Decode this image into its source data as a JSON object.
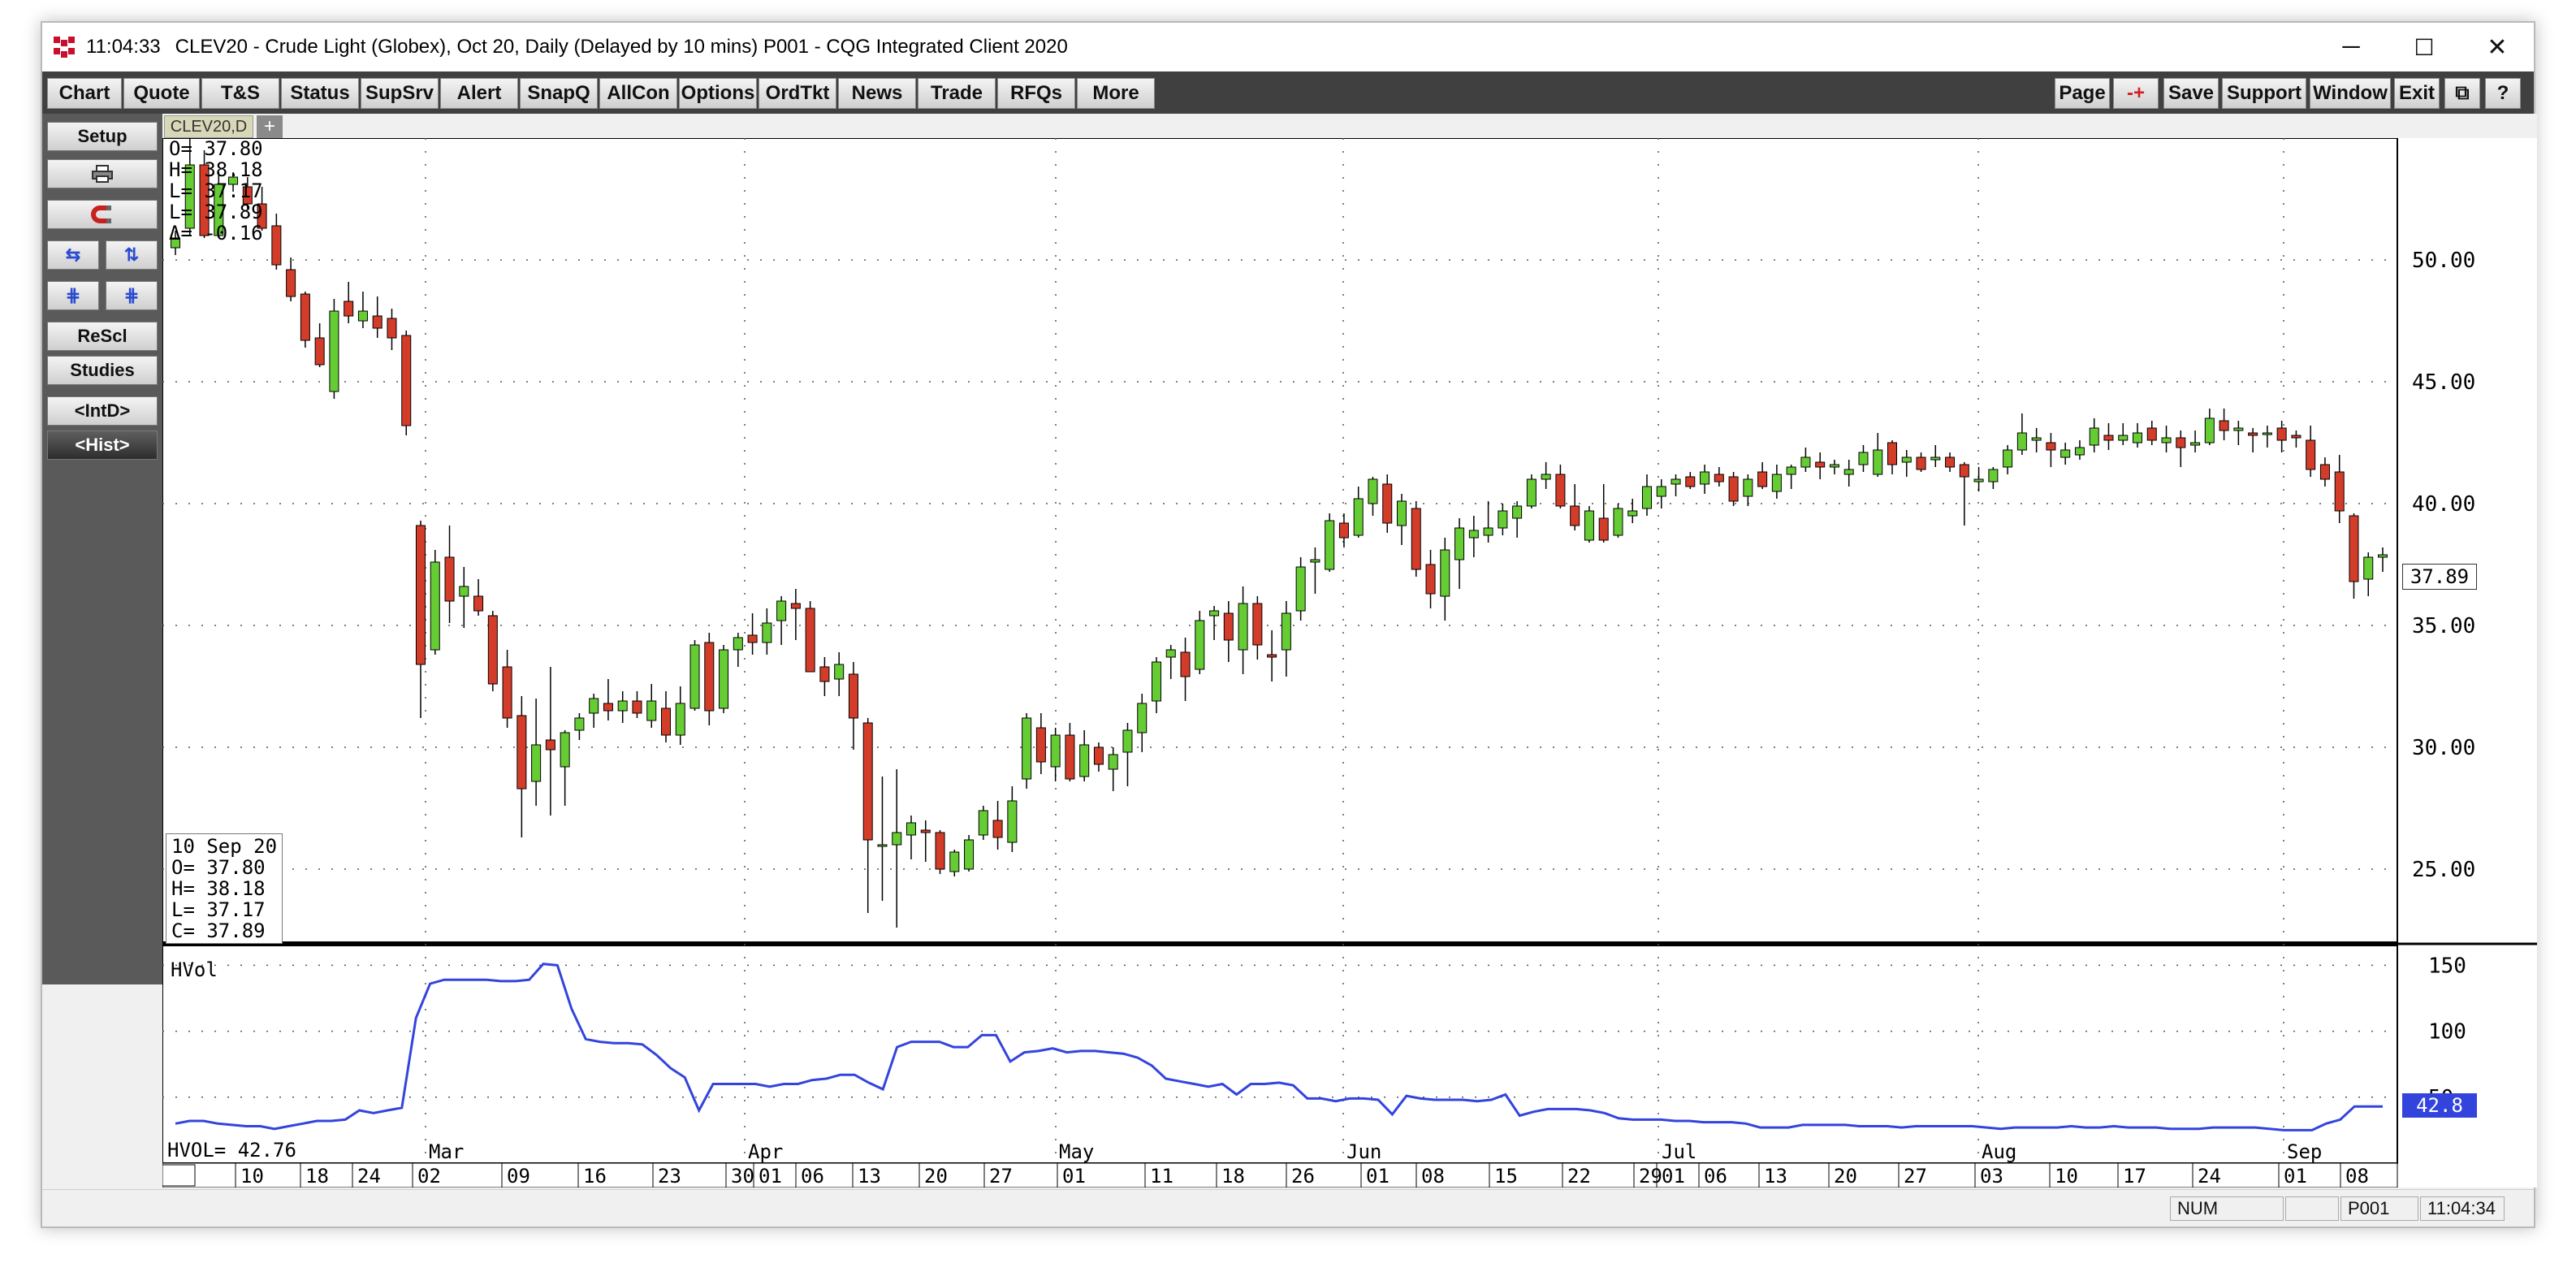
{
  "titlebar": {
    "time": "11:04:33",
    "title": "CLEV20 - Crude Light (Globex), Oct 20, Daily (Delayed by 10 mins)   P001 - CQG Integrated Client 2020",
    "minimize": "─",
    "maximize": "☐",
    "close": "✕"
  },
  "toolbar": {
    "left_buttons": [
      "Chart",
      "Quote",
      "T&S",
      "Status",
      "SupSrv",
      "Alert",
      "SnapQ",
      "AllCon",
      "Options",
      "OrdTkt",
      "News",
      "Trade",
      "RFQs",
      "More"
    ],
    "right_buttons": [
      "Page",
      "-+",
      "Save",
      "Support",
      "Window",
      "Exit",
      "⧉",
      "?"
    ]
  },
  "leftpanel": {
    "setup": "Setup",
    "print_icon": "print-icon",
    "magnet_icon": "magnet-icon",
    "arrows_lr": "⇆",
    "arrows_ud": "⇅",
    "grid_a": "⋕",
    "grid_b": "⋕",
    "rescl": "ReScl",
    "studies": "Studies",
    "intd": "<IntD>",
    "hist": "<Hist>"
  },
  "tabs": {
    "active": "CLEV20,D",
    "add": "+"
  },
  "ohlc_box": {
    "o": "O=  37.80",
    "h": "H=  38.18",
    "l": "L=  37.17",
    "l2": "L=  37.89",
    "d": "Δ=  -0.16"
  },
  "cursor_box": {
    "date": "10 Sep 20",
    "o": "O=   37.80",
    "h": "H=   38.18",
    "l": "L=   37.17",
    "c": "C=   37.89"
  },
  "last_price": "37.89",
  "hvol": {
    "label": "HVol",
    "readout": "HVOL=  42.76",
    "last": "42.8"
  },
  "status": {
    "num": "NUM",
    "page": "P001",
    "time": "11:04:34"
  },
  "chart_data": [
    {
      "type": "candlestick",
      "title": "",
      "ylim": [
        22,
        55
      ],
      "y_ticks": [
        "50.00",
        "45.00",
        "40.00",
        "35.00",
        "30.00",
        "25.00"
      ],
      "y_tick_values": [
        50,
        45,
        40,
        35,
        30,
        25
      ],
      "month_labels": [
        "Mar",
        "Apr",
        "May",
        "Jun",
        "Jul",
        "Aug",
        "Sep"
      ],
      "day_labels": [
        "10",
        "18",
        "24",
        "02",
        "09",
        "16",
        "23",
        "30",
        "01",
        "06",
        "13",
        "20",
        "27",
        "01",
        "11",
        "18",
        "26",
        "01",
        "08",
        "15",
        "22",
        "29",
        "01",
        "06",
        "13",
        "20",
        "27",
        "03",
        "10",
        "17",
        "24",
        "01",
        "08"
      ],
      "colors": {
        "up": "#66cc33",
        "down": "#d43c2a",
        "grid": "#555555"
      },
      "candles": [
        [
          50.5,
          51.2,
          50.2,
          50.9
        ],
        [
          51.3,
          56.0,
          51.0,
          53.9
        ],
        [
          53.9,
          54.5,
          50.9,
          51.0
        ],
        [
          51.0,
          53.6,
          50.9,
          53.1
        ],
        [
          53.1,
          53.6,
          52.8,
          53.4
        ],
        [
          53.0,
          53.4,
          52.1,
          52.3
        ],
        [
          52.3,
          53.0,
          51.2,
          51.3
        ],
        [
          51.4,
          51.9,
          49.6,
          49.8
        ],
        [
          49.6,
          50.1,
          48.3,
          48.5
        ],
        [
          48.6,
          48.7,
          46.4,
          46.7
        ],
        [
          46.8,
          47.4,
          45.6,
          45.7
        ],
        [
          44.6,
          48.4,
          44.3,
          47.9
        ],
        [
          48.3,
          49.1,
          47.4,
          47.7
        ],
        [
          47.5,
          48.7,
          47.2,
          47.9
        ],
        [
          47.7,
          48.5,
          46.8,
          47.2
        ],
        [
          47.6,
          48.0,
          46.3,
          46.8
        ],
        [
          46.9,
          47.1,
          42.8,
          43.2
        ],
        [
          39.1,
          39.3,
          31.2,
          33.4
        ],
        [
          34.0,
          38.1,
          33.8,
          37.6
        ],
        [
          37.8,
          39.1,
          35.1,
          36.0
        ],
        [
          36.2,
          37.4,
          34.9,
          36.6
        ],
        [
          36.2,
          36.9,
          35.4,
          35.6
        ],
        [
          35.4,
          35.6,
          32.3,
          32.6
        ],
        [
          33.3,
          34.0,
          30.8,
          31.2
        ],
        [
          31.3,
          32.1,
          26.3,
          28.3
        ],
        [
          28.6,
          32.0,
          27.6,
          30.1
        ],
        [
          30.3,
          33.3,
          27.2,
          29.9
        ],
        [
          29.2,
          30.7,
          27.6,
          30.6
        ],
        [
          30.7,
          31.4,
          30.3,
          31.2
        ],
        [
          31.4,
          32.2,
          30.8,
          32.0
        ],
        [
          31.8,
          32.8,
          31.1,
          31.5
        ],
        [
          31.5,
          32.3,
          31.0,
          31.9
        ],
        [
          31.9,
          32.3,
          31.2,
          31.4
        ],
        [
          31.1,
          32.6,
          30.8,
          31.9
        ],
        [
          31.6,
          32.3,
          30.2,
          30.5
        ],
        [
          30.5,
          32.5,
          30.1,
          31.8
        ],
        [
          31.6,
          34.4,
          31.5,
          34.2
        ],
        [
          34.3,
          34.7,
          30.9,
          31.5
        ],
        [
          31.6,
          34.2,
          31.4,
          34.0
        ],
        [
          34.0,
          34.7,
          33.3,
          34.5
        ],
        [
          34.6,
          35.5,
          33.8,
          34.3
        ],
        [
          34.3,
          35.7,
          33.8,
          35.1
        ],
        [
          35.2,
          36.2,
          34.2,
          36.0
        ],
        [
          35.9,
          36.5,
          34.4,
          35.7
        ],
        [
          35.7,
          36.0,
          33.1,
          33.1
        ],
        [
          33.3,
          33.7,
          32.1,
          32.7
        ],
        [
          32.8,
          33.9,
          32.1,
          33.4
        ],
        [
          33.0,
          33.5,
          29.9,
          31.2
        ],
        [
          31.0,
          31.2,
          23.2,
          26.2
        ],
        [
          26.0,
          28.8,
          23.7,
          26.0
        ],
        [
          26.0,
          29.1,
          22.6,
          26.5
        ],
        [
          26.4,
          27.2,
          25.4,
          26.9
        ],
        [
          26.6,
          27.0,
          25.3,
          26.5
        ],
        [
          26.5,
          26.6,
          24.8,
          25.0
        ],
        [
          24.9,
          25.8,
          24.7,
          25.7
        ],
        [
          25.0,
          26.4,
          24.9,
          26.2
        ],
        [
          26.4,
          27.6,
          26.2,
          27.4
        ],
        [
          27.0,
          27.8,
          25.8,
          26.3
        ],
        [
          26.1,
          28.4,
          25.7,
          27.8
        ],
        [
          28.7,
          31.4,
          28.3,
          31.2
        ],
        [
          30.8,
          31.4,
          28.9,
          29.4
        ],
        [
          29.2,
          30.8,
          28.6,
          30.5
        ],
        [
          30.5,
          31.0,
          28.6,
          28.7
        ],
        [
          28.8,
          30.7,
          28.6,
          30.1
        ],
        [
          30.0,
          30.2,
          29.0,
          29.3
        ],
        [
          29.1,
          30.0,
          28.2,
          29.7
        ],
        [
          29.8,
          31.0,
          28.4,
          30.7
        ],
        [
          30.6,
          32.2,
          29.8,
          31.8
        ],
        [
          31.9,
          33.7,
          31.4,
          33.5
        ],
        [
          33.7,
          34.2,
          32.8,
          34.0
        ],
        [
          33.9,
          34.5,
          31.9,
          32.9
        ],
        [
          33.2,
          35.6,
          33.0,
          35.2
        ],
        [
          35.4,
          35.8,
          34.4,
          35.6
        ],
        [
          35.5,
          36.0,
          33.5,
          34.4
        ],
        [
          34.0,
          36.6,
          33.0,
          35.9
        ],
        [
          35.9,
          36.2,
          33.6,
          34.2
        ],
        [
          33.8,
          34.8,
          32.7,
          33.7
        ],
        [
          34.0,
          36.0,
          32.9,
          35.5
        ],
        [
          35.6,
          37.8,
          35.2,
          37.4
        ],
        [
          37.6,
          38.2,
          36.3,
          37.7
        ],
        [
          37.3,
          39.6,
          37.2,
          39.3
        ],
        [
          39.2,
          39.6,
          38.2,
          38.6
        ],
        [
          38.7,
          40.7,
          38.6,
          40.2
        ],
        [
          40.0,
          41.1,
          39.5,
          41.0
        ],
        [
          40.8,
          41.2,
          38.8,
          39.2
        ],
        [
          39.1,
          40.4,
          38.3,
          40.1
        ],
        [
          39.8,
          40.1,
          37.0,
          37.3
        ],
        [
          37.5,
          38.1,
          35.7,
          36.3
        ],
        [
          36.2,
          38.6,
          35.2,
          38.1
        ],
        [
          37.7,
          39.4,
          36.5,
          39.0
        ],
        [
          38.6,
          39.5,
          37.8,
          38.9
        ],
        [
          38.7,
          40.1,
          38.4,
          39.0
        ],
        [
          39.0,
          40.0,
          38.7,
          39.7
        ],
        [
          39.4,
          40.1,
          38.6,
          39.9
        ],
        [
          39.9,
          41.2,
          39.8,
          41.0
        ],
        [
          41.0,
          41.7,
          40.6,
          41.2
        ],
        [
          41.2,
          41.6,
          39.8,
          39.9
        ],
        [
          39.9,
          40.8,
          38.9,
          39.1
        ],
        [
          38.5,
          39.9,
          38.4,
          39.7
        ],
        [
          39.4,
          40.8,
          38.4,
          38.5
        ],
        [
          38.7,
          40.0,
          38.6,
          39.8
        ],
        [
          39.5,
          40.2,
          39.2,
          39.7
        ],
        [
          39.8,
          41.2,
          39.5,
          40.7
        ],
        [
          40.3,
          41.0,
          39.8,
          40.7
        ],
        [
          40.8,
          41.2,
          40.3,
          41.0
        ],
        [
          41.1,
          41.3,
          40.6,
          40.7
        ],
        [
          40.8,
          41.6,
          40.4,
          41.3
        ],
        [
          41.2,
          41.5,
          40.7,
          40.9
        ],
        [
          41.1,
          41.3,
          39.9,
          40.1
        ],
        [
          40.3,
          41.2,
          39.9,
          41.0
        ],
        [
          41.3,
          41.7,
          40.6,
          40.7
        ],
        [
          40.5,
          41.6,
          40.2,
          41.2
        ],
        [
          41.2,
          41.6,
          40.6,
          41.5
        ],
        [
          41.5,
          42.3,
          41.3,
          41.9
        ],
        [
          41.7,
          42.1,
          41.0,
          41.5
        ],
        [
          41.5,
          41.8,
          41.2,
          41.6
        ],
        [
          41.2,
          41.8,
          40.7,
          41.4
        ],
        [
          41.6,
          42.4,
          41.3,
          42.1
        ],
        [
          41.2,
          42.9,
          41.1,
          42.2
        ],
        [
          42.5,
          42.6,
          41.2,
          41.6
        ],
        [
          41.7,
          42.2,
          41.1,
          41.9
        ],
        [
          41.9,
          42.1,
          41.3,
          41.4
        ],
        [
          41.8,
          42.4,
          41.5,
          41.9
        ],
        [
          41.9,
          42.1,
          41.3,
          41.5
        ],
        [
          41.6,
          41.7,
          39.1,
          41.1
        ],
        [
          40.9,
          41.5,
          40.5,
          41.0
        ],
        [
          40.9,
          41.5,
          40.6,
          41.4
        ],
        [
          41.5,
          42.4,
          41.2,
          42.2
        ],
        [
          42.2,
          43.7,
          42.0,
          42.9
        ],
        [
          42.6,
          43.1,
          42.1,
          42.7
        ],
        [
          42.5,
          42.9,
          41.5,
          42.2
        ],
        [
          41.9,
          42.5,
          41.6,
          42.2
        ],
        [
          42.0,
          42.6,
          41.8,
          42.3
        ],
        [
          42.4,
          43.5,
          42.1,
          43.1
        ],
        [
          42.8,
          43.3,
          42.2,
          42.6
        ],
        [
          42.6,
          43.3,
          42.4,
          42.8
        ],
        [
          42.5,
          43.3,
          42.3,
          42.9
        ],
        [
          43.1,
          43.4,
          42.4,
          42.6
        ],
        [
          42.5,
          43.2,
          42.1,
          42.7
        ],
        [
          42.7,
          43.0,
          41.5,
          42.3
        ],
        [
          42.4,
          43.0,
          42.1,
          42.5
        ],
        [
          42.5,
          43.9,
          42.4,
          43.5
        ],
        [
          43.4,
          43.9,
          42.6,
          43.0
        ],
        [
          43.0,
          43.4,
          42.4,
          43.1
        ],
        [
          42.9,
          43.1,
          42.1,
          42.8
        ],
        [
          42.9,
          43.2,
          42.3,
          42.9
        ],
        [
          43.1,
          43.4,
          42.1,
          42.6
        ],
        [
          42.8,
          43.0,
          42.3,
          42.7
        ],
        [
          42.6,
          43.2,
          41.1,
          41.4
        ],
        [
          41.6,
          41.9,
          40.7,
          41.0
        ],
        [
          41.3,
          42.0,
          39.2,
          39.7
        ],
        [
          39.5,
          39.6,
          36.1,
          36.8
        ],
        [
          36.9,
          38.0,
          36.2,
          37.8
        ],
        [
          37.8,
          38.2,
          37.2,
          37.9
        ]
      ]
    },
    {
      "type": "line",
      "title": "HVol",
      "ylim": [
        0,
        165
      ],
      "y_ticks": [
        "150",
        "100",
        "50"
      ],
      "y_tick_values": [
        150,
        100,
        50
      ],
      "colors": {
        "line": "#3344dd",
        "last_label_bg": "#3344dd"
      },
      "values": [
        30,
        32,
        32,
        30,
        29,
        28,
        28,
        26,
        28,
        30,
        32,
        32,
        33,
        40,
        38,
        40,
        42,
        110,
        136,
        139,
        139,
        139,
        139,
        138,
        138,
        139,
        151,
        150,
        117,
        94,
        92,
        91,
        91,
        90,
        82,
        72,
        65,
        40,
        60,
        60,
        60,
        60,
        58,
        60,
        60,
        63,
        64,
        67,
        67,
        61,
        56,
        88,
        92,
        92,
        92,
        88,
        88,
        97,
        97,
        77,
        84,
        85,
        87,
        84,
        85,
        85,
        84,
        83,
        80,
        74,
        64,
        62,
        60,
        58,
        60,
        52,
        60,
        60,
        61,
        59,
        49,
        49,
        47,
        49,
        49,
        48,
        37,
        51,
        49,
        48,
        48,
        48,
        47,
        48,
        52,
        36,
        39,
        41,
        41,
        41,
        40,
        38,
        34,
        33,
        33,
        33,
        32,
        32,
        31,
        31,
        31,
        30,
        27,
        27,
        27,
        29,
        29,
        29,
        29,
        28,
        28,
        28,
        27,
        28,
        28,
        28,
        28,
        28,
        27,
        26,
        27,
        27,
        27,
        27,
        28,
        27,
        27,
        28,
        27,
        27,
        27,
        26,
        26,
        26,
        27,
        27,
        27,
        27,
        26,
        25,
        25,
        25,
        30,
        33,
        43,
        43,
        43
      ]
    }
  ]
}
